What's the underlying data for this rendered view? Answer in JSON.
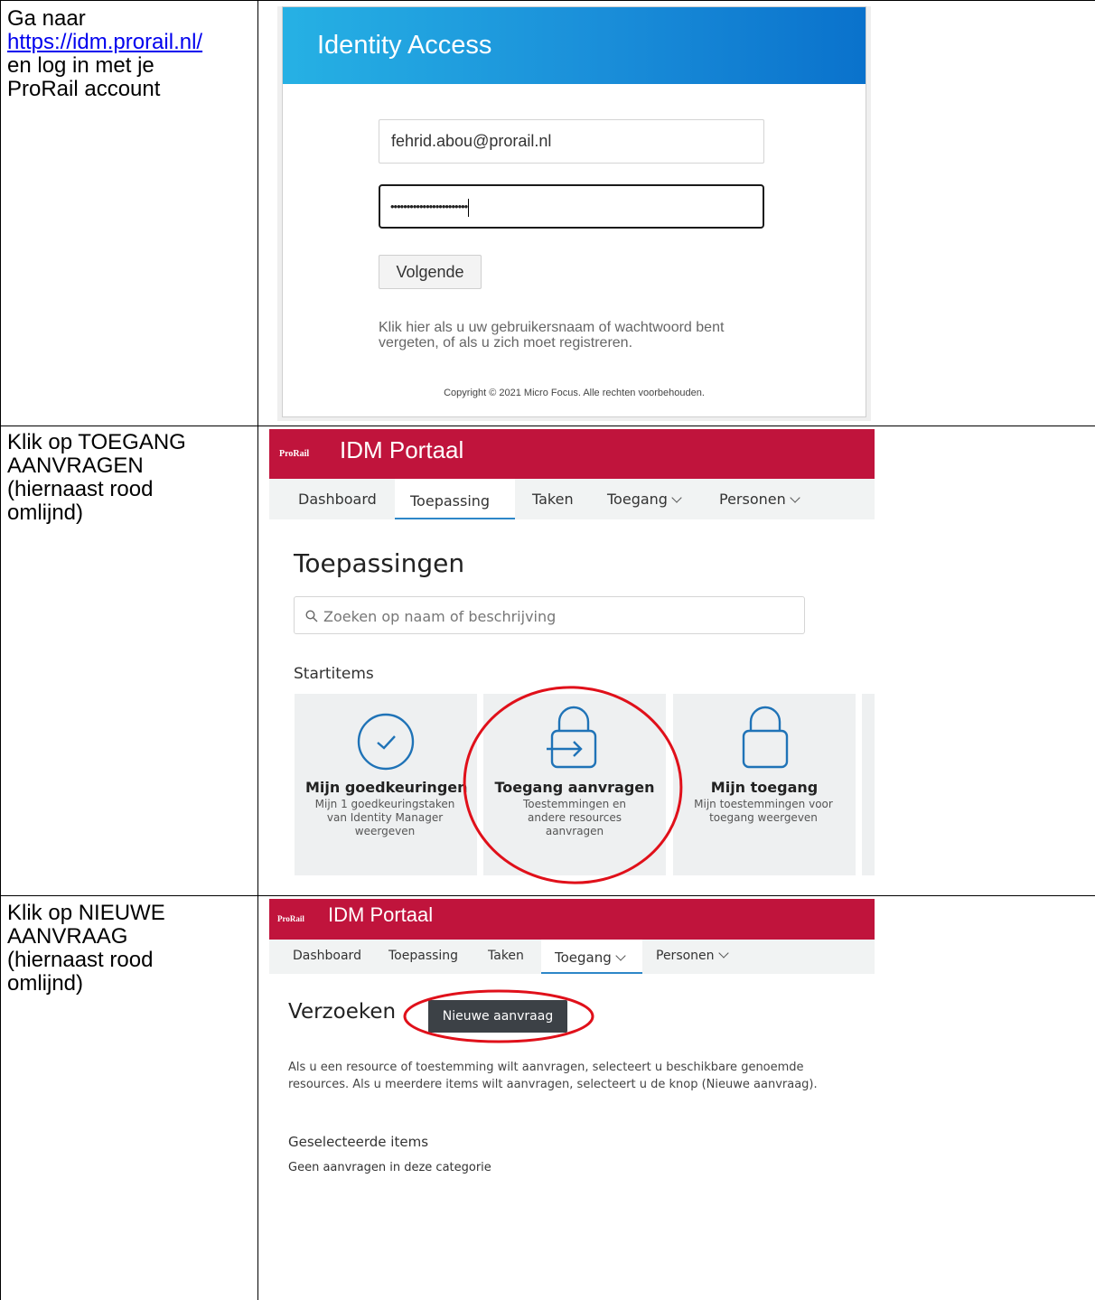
{
  "rows": [
    {
      "instruction": {
        "line1": "Ga naar",
        "link": "https://idm.prorail.nl/",
        "line2": "en log in met je",
        "line3": "ProRail account"
      },
      "login": {
        "header_title": "Identity Access",
        "username_value": "fehrid.abou@prorail.nl",
        "password_masked": "••••••••••••••••••••••••",
        "next_label": "Volgende",
        "help_text": "Klik hier als u uw gebruikersnaam of wachtwoord bent vergeten, of als u zich moet registreren.",
        "copyright": "Copyright © 2021 Micro Focus. Alle rechten voorbehouden."
      }
    },
    {
      "instruction": {
        "line1": "Klik op TOEGANG",
        "line2": "AANVRAGEN",
        "line3": "(hiernaast rood",
        "line4": "omlijnd)"
      },
      "portal": {
        "brand_small": "ProRail",
        "brand_title": "IDM Portaal",
        "nav": [
          "Dashboard",
          "Toepassing",
          "Taken",
          "Toegang",
          "Personen"
        ],
        "active_nav": "Toepassing",
        "page_title": "Toepassingen",
        "search_placeholder": "Zoeken op naam of beschrijving",
        "section_title": "Startitems",
        "tiles": [
          {
            "title": "Mijn goedkeuringen",
            "desc": "Mijn 1 goedkeuringstaken van Identity Manager weergeven",
            "icon": "check-circle-icon"
          },
          {
            "title": "Toegang aanvragen",
            "desc": "Toestemmingen en andere resources aanvragen",
            "icon": "lock-request-icon"
          },
          {
            "title": "Mijn toegang",
            "desc": "Mijn toestemmingen voor toegang weergeven",
            "icon": "lock-icon"
          }
        ]
      }
    },
    {
      "instruction": {
        "line1": "Klik op NIEUWE",
        "line2": "AANVRAAG",
        "line3": "(hiernaast rood",
        "line4": "omlijnd)"
      },
      "portal": {
        "brand_small": "ProRail",
        "brand_title": "IDM Portaal",
        "nav": [
          "Dashboard",
          "Toepassing",
          "Taken",
          "Toegang",
          "Personen"
        ],
        "active_nav": "Toegang",
        "page_title": "Verzoeken",
        "new_request_label": "Nieuwe aanvraag",
        "description": "Als u een resource of toestemming wilt aanvragen, selecteert u beschikbare genoemde resources. Als u meerdere items wilt aanvragen, selecteert u de knop (Nieuwe aanvraag).",
        "selected_title": "Geselecteerde items",
        "empty_text": "Geen aanvragen in deze categorie"
      }
    }
  ],
  "colors": {
    "portal_red": "#c0143c",
    "login_blue": "#1a8ed9",
    "highlight_red": "#e0101a",
    "icon_blue": "#1f73b7"
  }
}
